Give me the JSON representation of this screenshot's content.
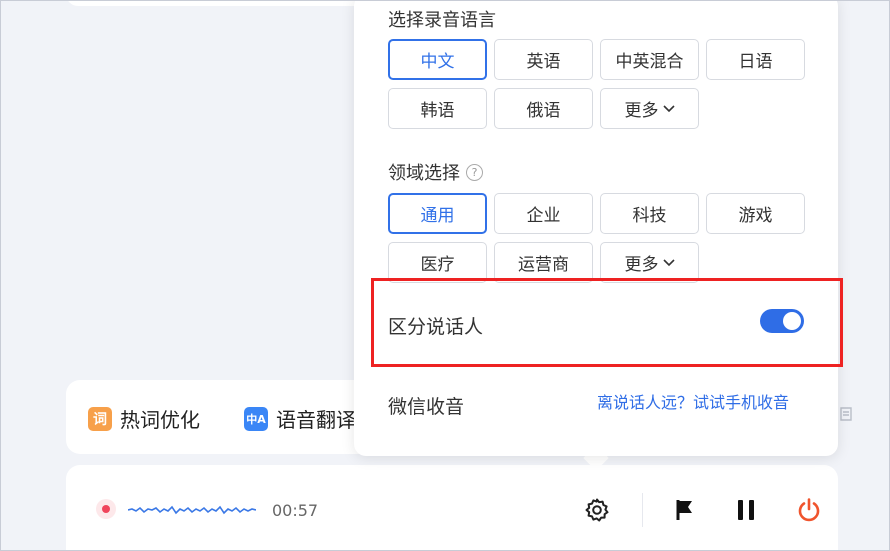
{
  "tools": [
    {
      "label": "热词优化",
      "icon": "词",
      "icon_name": "hotword-icon"
    },
    {
      "label": "语音翻译",
      "icon": "中A",
      "icon_name": "translate-icon"
    }
  ],
  "recording": {
    "time": "00:57"
  },
  "popup": {
    "language_title": "选择录音语言",
    "languages": [
      "中文",
      "英语",
      "中英混合",
      "日语",
      "韩语",
      "俄语",
      "更多"
    ],
    "selected_language": "中文",
    "domain_title": "领域选择",
    "domains": [
      "通用",
      "企业",
      "科技",
      "游戏",
      "医疗",
      "运营商",
      "更多"
    ],
    "selected_domain": "通用",
    "speaker_label": "区分说话人",
    "speaker_on": true,
    "wechat_label": "微信收音",
    "wechat_link": "离说话人远？试试手机收音"
  },
  "colors": {
    "accent": "#2f6de6",
    "record": "#f0445b",
    "power": "#f0542d",
    "highlight": "#ee2222"
  }
}
